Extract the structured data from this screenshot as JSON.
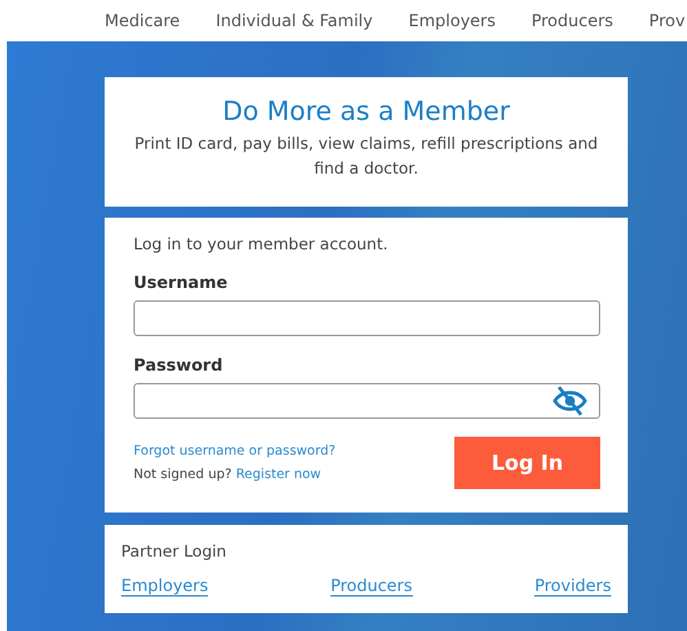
{
  "top_nav": [
    {
      "label": "Medicare"
    },
    {
      "label": "Individual & Family"
    },
    {
      "label": "Employers"
    },
    {
      "label": "Producers"
    },
    {
      "label": "Prov"
    }
  ],
  "promo": {
    "title": "Do More as a Member",
    "text": "Print ID card, pay bills, view claims, refill prescriptions and find a doctor."
  },
  "login": {
    "intro": "Log in to your member account.",
    "username_label": "Username",
    "password_label": "Password",
    "forgot_link": "Forgot username or password?",
    "signup_text": "Not signed up?",
    "register_link": "Register now",
    "button": "Log In"
  },
  "partner": {
    "title": "Partner Login",
    "links": [
      "Employers",
      "Producers",
      "Providers"
    ]
  }
}
